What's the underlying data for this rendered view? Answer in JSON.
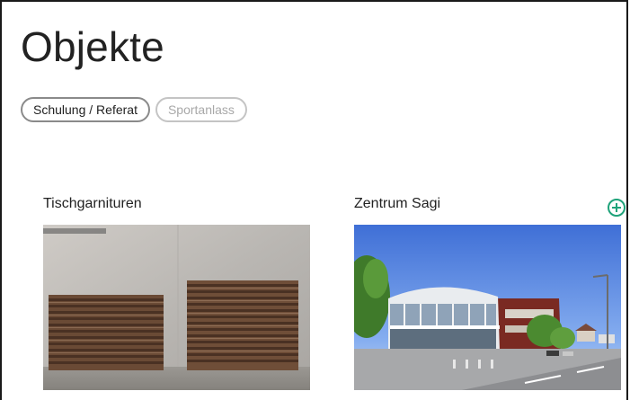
{
  "page": {
    "title": "Objekte"
  },
  "filters": [
    {
      "label": "Schulung / Referat",
      "active": true
    },
    {
      "label": "Sportanlass",
      "active": false
    }
  ],
  "cards": [
    {
      "title": "Tischgarnituren",
      "image_icon": "stacked-tables-photo"
    },
    {
      "title": "Zentrum Sagi",
      "image_icon": "building-photo",
      "action_icon": "add-circle-icon"
    }
  ],
  "colors": {
    "accent": "#1fa37a",
    "chip_border": "#8a8a8a",
    "chip_inactive": "#c4c4c4"
  }
}
